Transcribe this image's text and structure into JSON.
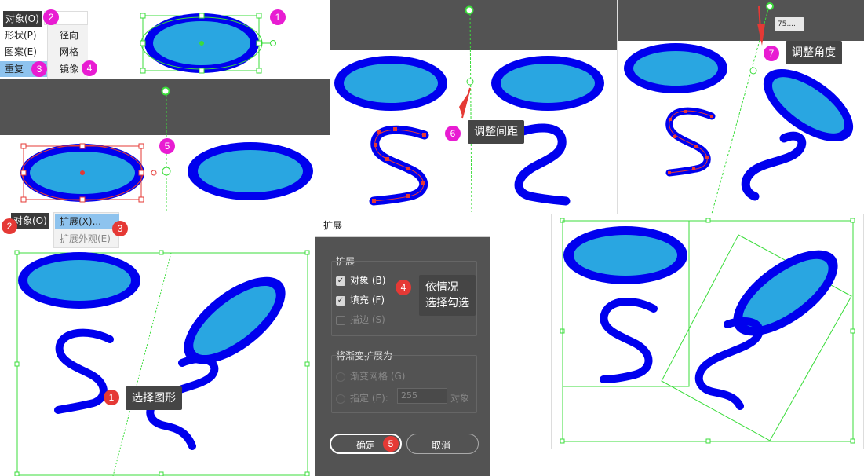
{
  "menu1": {
    "object": "对象(O)",
    "items": [
      "形状(P)",
      "图案(E)",
      "重复"
    ],
    "submenu": [
      "径向",
      "网格",
      "镜像"
    ]
  },
  "menu2": {
    "object": "对象(O)",
    "expand": "扩展(X)...",
    "expand_appearance": "扩展外观(E)"
  },
  "steps": {
    "s1": "1",
    "s2": "2",
    "s3": "3",
    "s4": "4",
    "s5": "5",
    "s6": "6",
    "s7": "7",
    "b2": "2",
    "b3": "3",
    "b1": "1",
    "d4": "4",
    "d5": "5"
  },
  "tips": {
    "spacing": "调整间距",
    "angle": "调整角度",
    "select": "选择图形",
    "condition": "依情况\n选择勾选"
  },
  "angle_readout": "75....",
  "dialog": {
    "title": "扩展",
    "group1": "扩展",
    "object": "对象 (B)",
    "fill": "填充 (F)",
    "stroke": "描边 (S)",
    "group2": "将渐变扩展为",
    "mesh": "渐变网格 (G)",
    "specify": "指定 (E):",
    "specify_value": "255",
    "specify_unit": "对象",
    "ok": "确定",
    "cancel": "取消"
  },
  "colors": {
    "fill": "#29a6e1",
    "stroke": "#0000ee",
    "guide": "#3bdc3b",
    "badge_magenta": "#e81cd2",
    "badge_red": "#e53935"
  }
}
